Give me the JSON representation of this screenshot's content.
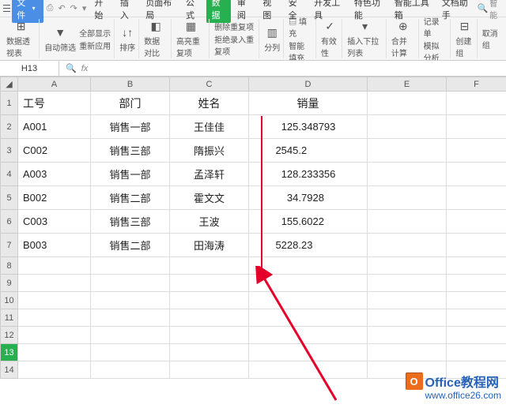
{
  "menubar": {
    "file": "文件",
    "items": [
      "开始",
      "插入",
      "页面布局",
      "公式",
      "数据",
      "审阅",
      "视图",
      "安全",
      "开发工具",
      "特色功能",
      "智能工具箱",
      "文档助手"
    ],
    "active_index": 4,
    "search_placeholder": "智能"
  },
  "ribbon": {
    "pivot": "数据透视表",
    "autofilter": "自动筛选",
    "showall": "全部显示",
    "reapply": "重新应用",
    "sort": "排序",
    "validation": "数据对比",
    "highlight_dup": "高亮重复项",
    "remove_dup": "删除重复项",
    "reject_dup": "拒绝录入重复项",
    "text_to_col": "分列",
    "fill": "填充",
    "smart_fill": "智能填充",
    "validity": "有效性",
    "dropdown": "插入下拉列表",
    "consolidate": "合并计算",
    "record": "记录单",
    "simulate": "模拟分析",
    "group": "创建组",
    "ungroup": "取消组"
  },
  "formula_bar": {
    "name_box": "H13",
    "fx": "fx"
  },
  "columns": [
    "A",
    "B",
    "C",
    "D",
    "E",
    "F"
  ],
  "header_row": {
    "a": "工号",
    "b": "部门",
    "c": "姓名",
    "d": "销量"
  },
  "rows": [
    {
      "n": "1",
      "a": "工号",
      "b": "部门",
      "c": "姓名",
      "d_int": "销量",
      "d_dec": "",
      "header": true
    },
    {
      "n": "2",
      "a": "A001",
      "b": "销售一部",
      "c": "王佳佳",
      "d_int": "125.",
      "d_dec": "348793"
    },
    {
      "n": "3",
      "a": "C002",
      "b": "销售三部",
      "c": "隋振兴",
      "d_int": "2545.",
      "d_dec": "2"
    },
    {
      "n": "4",
      "a": "A003",
      "b": "销售一部",
      "c": "孟泽轩",
      "d_int": "128.",
      "d_dec": "233356"
    },
    {
      "n": "5",
      "a": "B002",
      "b": "销售二部",
      "c": "霍文文",
      "d_int": "34.",
      "d_dec": "7928"
    },
    {
      "n": "6",
      "a": "C003",
      "b": "销售三部",
      "c": "王波",
      "d_int": "155.",
      "d_dec": "6022"
    },
    {
      "n": "7",
      "a": "B003",
      "b": "销售二部",
      "c": "田海涛",
      "d_int": "5228.",
      "d_dec": "23"
    }
  ],
  "empty_rows": [
    "8",
    "9",
    "10",
    "11",
    "12",
    "13",
    "14"
  ],
  "selected_row": "13",
  "watermark": {
    "brand": "Office教程网",
    "url": "www.office26.com"
  },
  "colors": {
    "accent": "#27b050",
    "arrow": "#e4002b",
    "brand_blue": "#2862b7",
    "brand_orange": "#ec6c1c"
  }
}
